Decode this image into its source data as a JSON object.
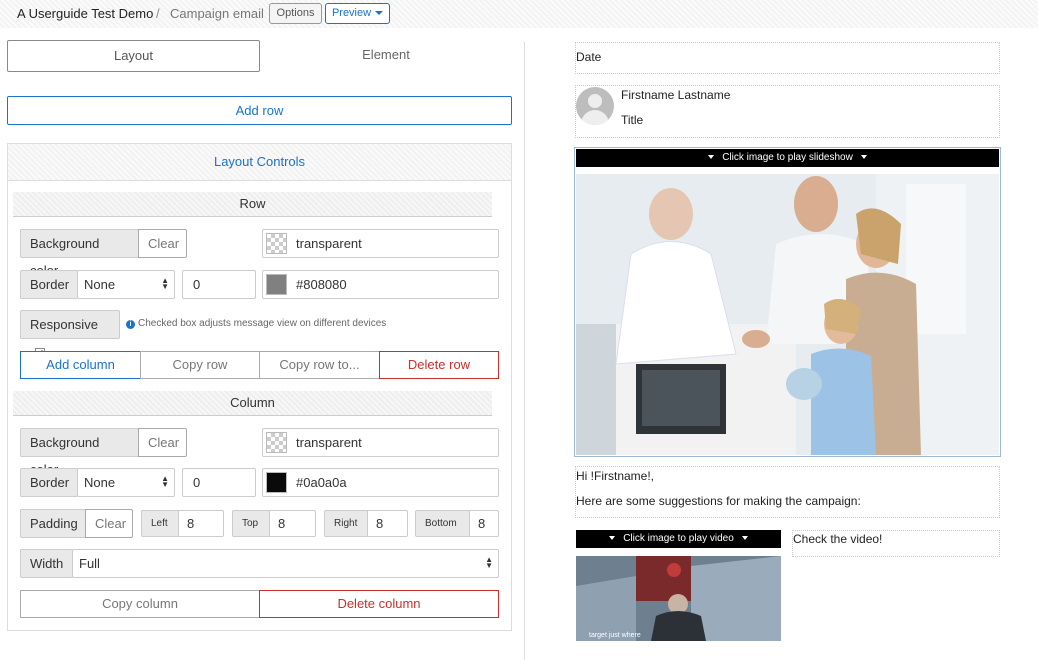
{
  "header": {
    "app_title": "A Userguide Test Demo",
    "separator": "/",
    "page_title": "Campaign email",
    "options_label": "Options",
    "preview_label": "Preview"
  },
  "tabs": [
    {
      "label": "Layout",
      "active": true
    },
    {
      "label": "Element",
      "active": false
    }
  ],
  "add_row_label": "Add row",
  "controls": {
    "title": "Layout Controls",
    "row": {
      "title": "Row",
      "background_label": "Background color",
      "clear_label": "Clear",
      "background_value": "transparent",
      "border_label": "Border",
      "border_style": "None",
      "border_width": "0",
      "border_color": "#808080",
      "responsive_label": "Responsive",
      "responsive_checked": "✔",
      "responsive_hint": "Checked box adjusts message view on different devices",
      "actions": {
        "add_column": "Add column",
        "copy_row": "Copy row",
        "copy_row_to": "Copy row to...",
        "delete_row": "Delete row"
      }
    },
    "column": {
      "title": "Column",
      "background_label": "Background color",
      "clear_label": "Clear",
      "background_value": "transparent",
      "border_label": "Border",
      "border_style": "None",
      "border_width": "0",
      "border_color": "#0a0a0a",
      "padding_label": "Padding",
      "padding_clear": "Clear",
      "padding_left_label": "Left",
      "padding_left": "8",
      "padding_top_label": "Top",
      "padding_top": "8",
      "padding_right_label": "Right",
      "padding_right": "8",
      "padding_bottom_label": "Bottom",
      "padding_bottom": "8",
      "width_label": "Width",
      "width_value": "Full",
      "actions": {
        "copy_column": "Copy column",
        "delete_column": "Delete column"
      }
    }
  },
  "preview": {
    "date": "Date",
    "name": "Firstname Lastname",
    "title": "Title",
    "slideshow_label": "Click image to play slideshow",
    "greeting": "Hi !Firstname!,",
    "body": "Here are some suggestions for making the campaign:",
    "video_label": "Click image to play video",
    "check_video": "Check the video!",
    "video_caption": "target just where"
  },
  "colors": {
    "accent": "#1a73c9",
    "danger": "#c9302c"
  }
}
